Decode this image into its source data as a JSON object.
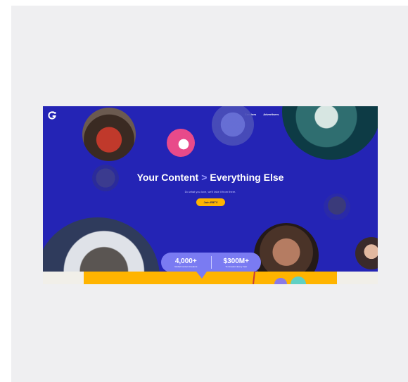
{
  "nav": {
    "items": [
      "Creators",
      "Advertisers",
      "Media Companies",
      "About Us",
      "Blog",
      "More",
      "English"
    ]
  },
  "hero": {
    "headline_left": "Your Content",
    "headline_chevron": ">",
    "headline_right": "Everything Else",
    "subtitle": "Do what you love, we'll take it from there.",
    "cta_label": "Join EBTV"
  },
  "stats": [
    {
      "value": "4,000+",
      "label": "Global Content Creators"
    },
    {
      "value": "$300M+",
      "label": "To Creators Every Year"
    }
  ],
  "colors": {
    "hero_bg": "#2424b5",
    "accent_yellow": "#ffb400",
    "stats_pill": "#7a7bf2"
  },
  "icons": [
    "logo-icon"
  ]
}
